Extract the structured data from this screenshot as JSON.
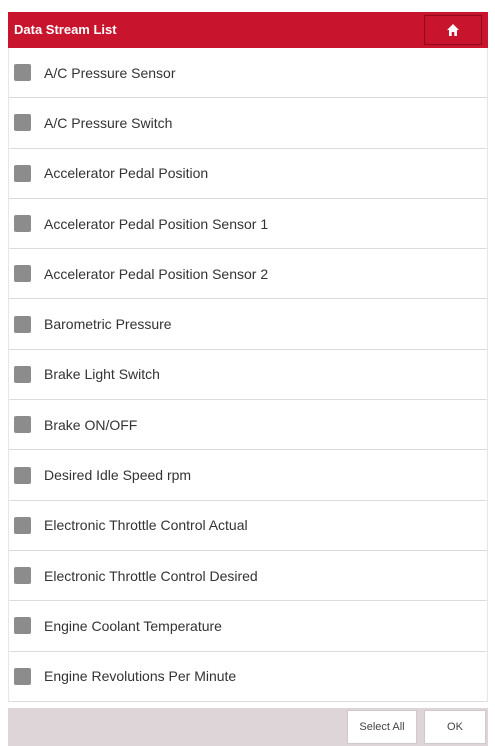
{
  "header": {
    "title": "Data Stream List",
    "home_icon": "home-icon"
  },
  "items": [
    {
      "label": "A/C Pressure Sensor",
      "checked": false
    },
    {
      "label": "A/C Pressure Switch",
      "checked": false
    },
    {
      "label": "Accelerator Pedal Position",
      "checked": false
    },
    {
      "label": "Accelerator Pedal Position Sensor 1",
      "checked": false
    },
    {
      "label": "Accelerator Pedal Position Sensor 2",
      "checked": false
    },
    {
      "label": "Barometric Pressure",
      "checked": false
    },
    {
      "label": "Brake Light Switch",
      "checked": false
    },
    {
      "label": "Brake ON/OFF",
      "checked": false
    },
    {
      "label": "Desired Idle Speed rpm",
      "checked": false
    },
    {
      "label": "Electronic Throttle Control Actual",
      "checked": false
    },
    {
      "label": "Electronic Throttle Control Desired",
      "checked": false
    },
    {
      "label": "Engine Coolant Temperature",
      "checked": false
    },
    {
      "label": "Engine Revolutions Per Minute",
      "checked": false
    }
  ],
  "footer": {
    "select_all_label": "Select All",
    "ok_label": "OK"
  },
  "colors": {
    "header_bg": "#c8142c",
    "checkbox": "#8c8c8c",
    "footer_bg": "#ddd5d7"
  }
}
